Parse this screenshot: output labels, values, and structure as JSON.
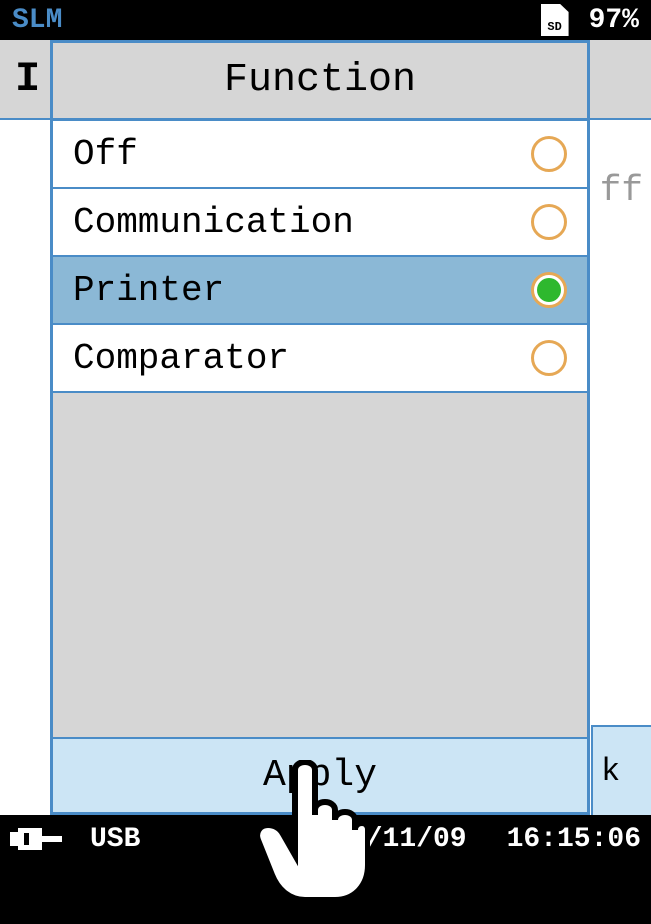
{
  "status": {
    "mode": "SLM",
    "sd_label": "SD",
    "battery": "97%"
  },
  "background": {
    "header_prefix": "I",
    "right_text": "ff",
    "right_k": "k"
  },
  "dialog": {
    "title": "Function",
    "options": [
      {
        "label": "Off",
        "selected": false
      },
      {
        "label": "Communication",
        "selected": false
      },
      {
        "label": "Printer",
        "selected": true
      },
      {
        "label": "Comparator",
        "selected": false
      }
    ],
    "apply_label": "Apply"
  },
  "bottom": {
    "connection": "USB",
    "date": "/11/09",
    "time": "16:15:06"
  }
}
